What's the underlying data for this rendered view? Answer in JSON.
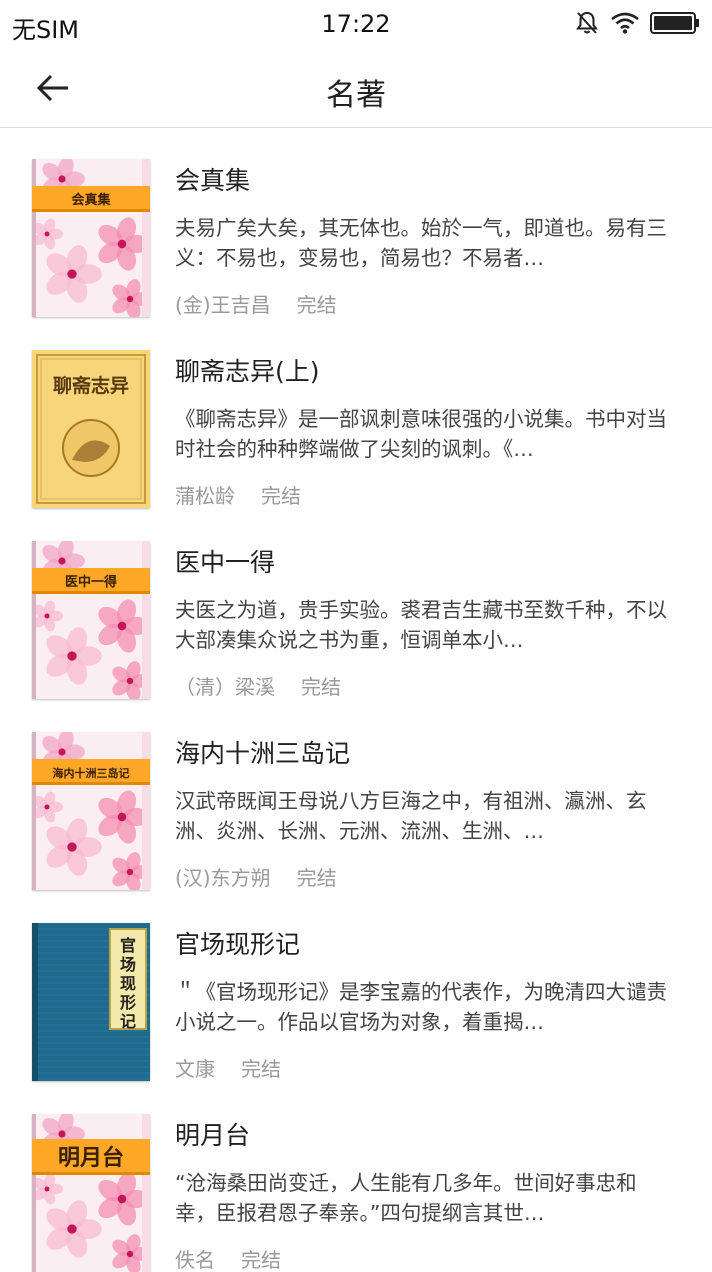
{
  "status_bar": {
    "carrier": "无SIM",
    "time": "17:22"
  },
  "nav": {
    "title": "名著"
  },
  "books": [
    {
      "title": "会真集",
      "cover_text": "会真集",
      "cover_style": "flower",
      "desc": "夫易广矣大矣，其无体也。始於一气，即道也。易有三义：不易也，变易也，简易也？不易者…",
      "author": "(金)王吉昌",
      "status": "完结"
    },
    {
      "title": "聊斋志异(上)",
      "cover_text": "聊斋志异",
      "cover_style": "yellow",
      "desc": "《聊斋志异》是一部讽刺意味很强的小说集。书中对当时社会的种种弊端做了尖刻的讽刺。《…",
      "author": "蒲松龄",
      "status": "完结"
    },
    {
      "title": "医中一得",
      "cover_text": "医中一得",
      "cover_style": "flower",
      "desc": "夫医之为道，贵手实验。裘君吉生藏书至数千种，不以大部凑集众说之书为重，恒调单本小…",
      "author": "（清）梁溪",
      "status": "完结"
    },
    {
      "title": "海内十洲三岛记",
      "cover_text": "海内十洲三岛记",
      "cover_style": "flower",
      "desc": "汉武帝既闻王母说八方巨海之中，有祖洲、瀛洲、玄洲、炎洲、长洲、元洲、流洲、生洲、…",
      "author": "(汉)东方朔",
      "status": "完结"
    },
    {
      "title": "官场现形记",
      "cover_text": "官场现形记",
      "cover_style": "blue",
      "desc": "＂《官场现形记》是李宝嘉的代表作，为晚清四大谴责小说之一。作品以官场为对象，着重揭…",
      "author": "文康",
      "status": "完结"
    },
    {
      "title": "明月台",
      "cover_text": "明月台",
      "cover_style": "flower-large",
      "desc": "“沧海桑田尚变迁，人生能有几多年。世间好事忠和幸，臣报君恩子奉亲。”四句提纲言其世…",
      "author": "佚名",
      "status": "完结"
    }
  ]
}
